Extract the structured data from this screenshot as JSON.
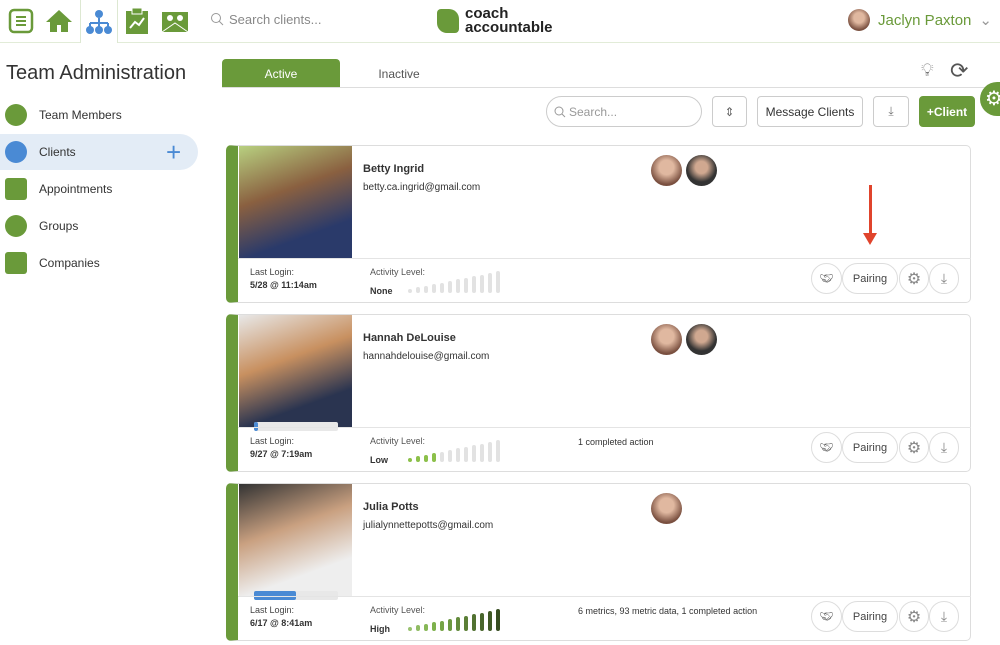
{
  "topbar": {
    "search_placeholder": "Search clients...",
    "logo": "coach accountable",
    "user": "Jaclyn Paxton"
  },
  "sidebar": {
    "title": "Team Administration",
    "items": [
      {
        "label": "Team Members"
      },
      {
        "label": "Clients"
      },
      {
        "label": "Appointments"
      },
      {
        "label": "Groups"
      },
      {
        "label": "Companies"
      }
    ]
  },
  "tabs": {
    "active": "Active",
    "inactive": "Inactive"
  },
  "toolbar": {
    "search_placeholder": "Search...",
    "message": "Message Clients",
    "add": "+Client"
  },
  "labels": {
    "last_login": "Last Login:",
    "activity": "Activity Level:",
    "pairing": "Pairing"
  },
  "colors": {
    "brand": "#6a9a3a",
    "accent": "#4a8ad4",
    "arrow": "#e0442c"
  },
  "clients": [
    {
      "name": "Betty Ingrid",
      "email": "betty.ca.ingrid@gmail.com",
      "last_login": "5/28 @ 11:14am",
      "activity": "None",
      "activity_bars": 0,
      "summary": "",
      "coaches": 2,
      "progress": 0
    },
    {
      "name": "Hannah DeLouise",
      "email": "hannahdelouise@gmail.com",
      "last_login": "9/27 @ 7:19am",
      "activity": "Low",
      "activity_bars": 4,
      "summary": "1 completed action",
      "coaches": 2,
      "progress": 5
    },
    {
      "name": "Julia Potts",
      "email": "julialynnettepotts@gmail.com",
      "last_login": "6/17 @ 8:41am",
      "activity": "High",
      "activity_bars": 12,
      "summary": "6 metrics, 93 metric data, 1 completed action",
      "coaches": 1,
      "progress": 50
    }
  ]
}
